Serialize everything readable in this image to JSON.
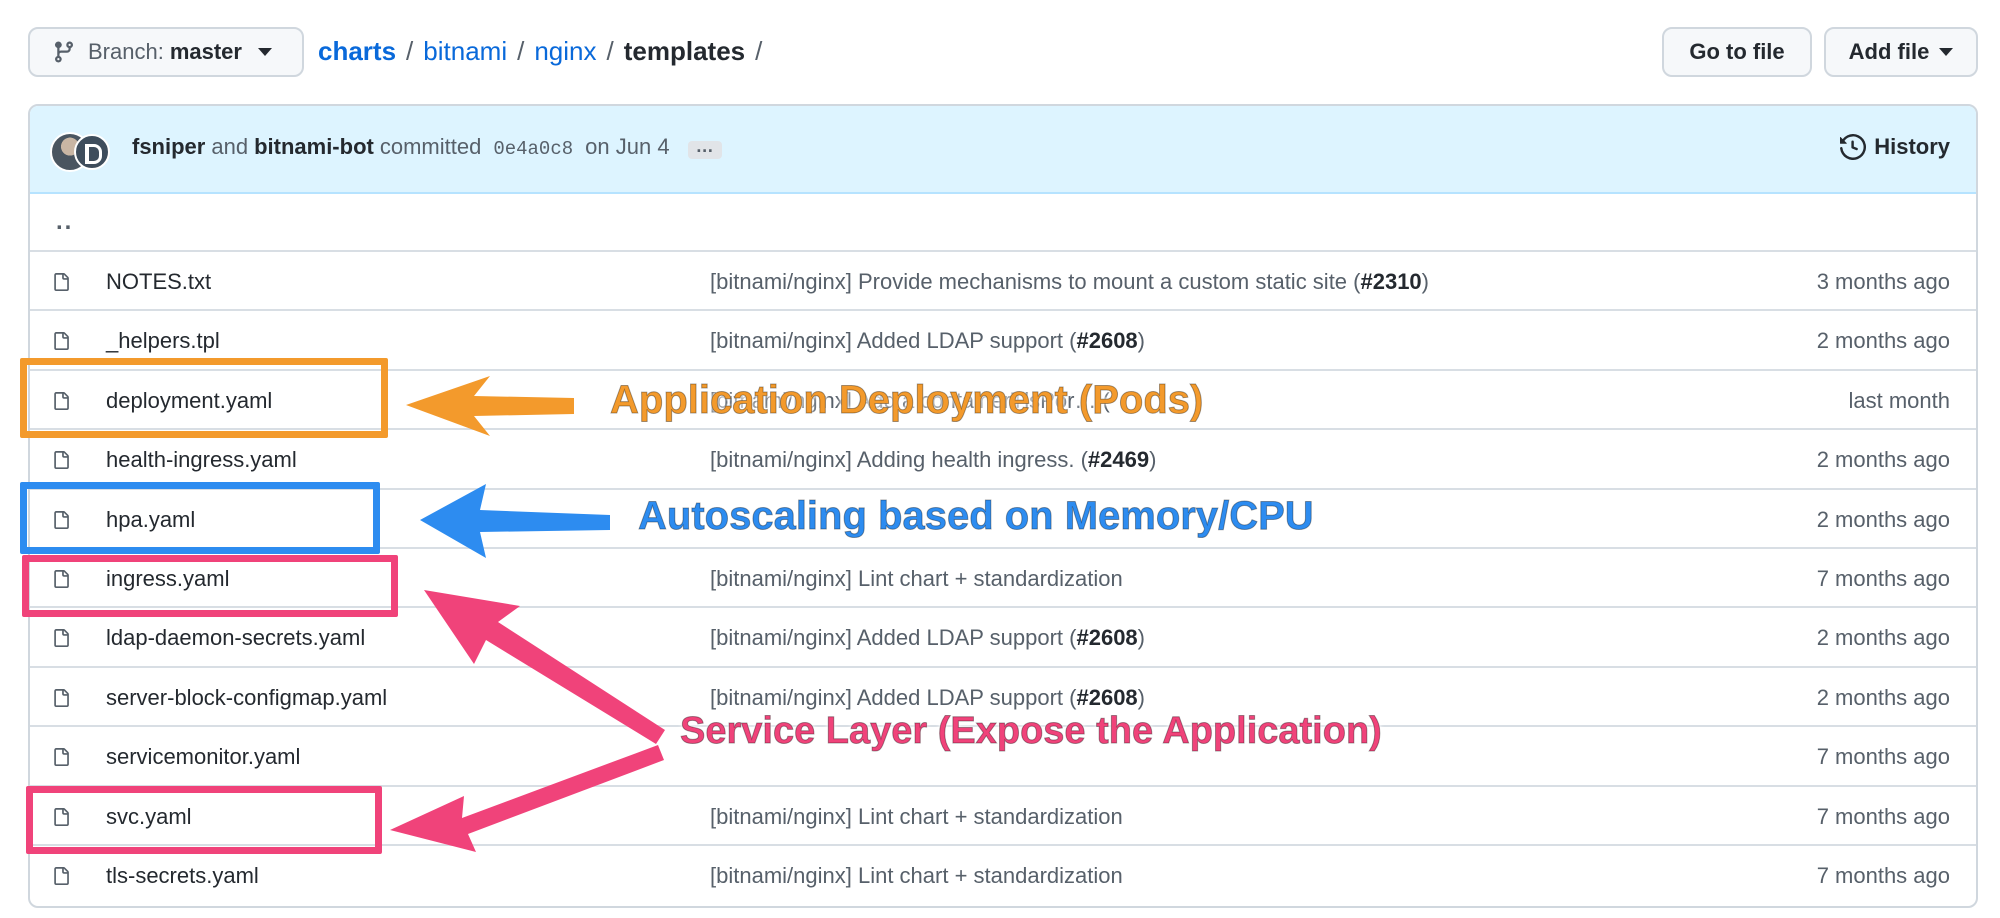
{
  "header": {
    "branch_label": "Branch:",
    "branch_name": "master",
    "breadcrumb": [
      "charts",
      "bitnami",
      "nginx",
      "templates"
    ],
    "goto_label": "Go to file",
    "add_label": "Add file"
  },
  "commit": {
    "author1": "fsniper",
    "and_text": "and",
    "author2": "bitnami-bot",
    "committed_text": "committed",
    "sha": "0e4a0c8",
    "date": "on Jun 4",
    "ellipsis": "…",
    "history_label": "History"
  },
  "parent_dir": "..",
  "files": [
    {
      "name": "NOTES.txt",
      "msg_prefix": "[bitnami/nginx] Provide mechanisms to mount a custom static site (",
      "pr": "#2310",
      "msg_suffix": ")",
      "age": "3 months ago"
    },
    {
      "name": "_helpers.tpl",
      "msg_prefix": "[bitnami/nginx] Added LDAP support (",
      "pr": "#2608",
      "msg_suffix": ")",
      "age": "2 months ago"
    },
    {
      "name": "deployment.yaml",
      "msg_prefix": "[bitnami/nginx] Add a containerTlsPor… (",
      "pr": "",
      "msg_suffix": "",
      "age": "last month"
    },
    {
      "name": "health-ingress.yaml",
      "msg_prefix": "[bitnami/nginx] Adding health ingress. (",
      "pr": "#2469",
      "msg_suffix": ")",
      "age": "2 months ago"
    },
    {
      "name": "hpa.yaml",
      "msg_prefix": "",
      "pr": "",
      "msg_suffix": "",
      "age": "2 months ago"
    },
    {
      "name": "ingress.yaml",
      "msg_prefix": "[bitnami/nginx] Lint chart + standardization",
      "pr": "",
      "msg_suffix": "",
      "age": "7 months ago"
    },
    {
      "name": "ldap-daemon-secrets.yaml",
      "msg_prefix": "[bitnami/nginx] Added LDAP support (",
      "pr": "#2608",
      "msg_suffix": ")",
      "age": "2 months ago"
    },
    {
      "name": "server-block-configmap.yaml",
      "msg_prefix": "[bitnami/nginx] Added LDAP support (",
      "pr": "#2608",
      "msg_suffix": ")",
      "age": "2 months ago"
    },
    {
      "name": "servicemonitor.yaml",
      "msg_prefix": "",
      "pr": "",
      "msg_suffix": "",
      "age": "7 months ago"
    },
    {
      "name": "svc.yaml",
      "msg_prefix": "[bitnami/nginx] Lint chart + standardization",
      "pr": "",
      "msg_suffix": "",
      "age": "7 months ago"
    },
    {
      "name": "tls-secrets.yaml",
      "msg_prefix": "[bitnami/nginx] Lint chart + standardization",
      "pr": "",
      "msg_suffix": "",
      "age": "7 months ago"
    }
  ],
  "annotations": {
    "deployment": {
      "text": "Application Deployment (Pods)",
      "color": "#f39a2c"
    },
    "hpa": {
      "text": "Autoscaling based on Memory/CPU",
      "color": "#2d8cf0"
    },
    "service": {
      "text": "Service Layer (Expose the Application)",
      "color": "#f0437a"
    }
  },
  "colors": {
    "link": "#0969da",
    "commit_bar": "#ddf4ff",
    "border": "#d0d7de"
  }
}
